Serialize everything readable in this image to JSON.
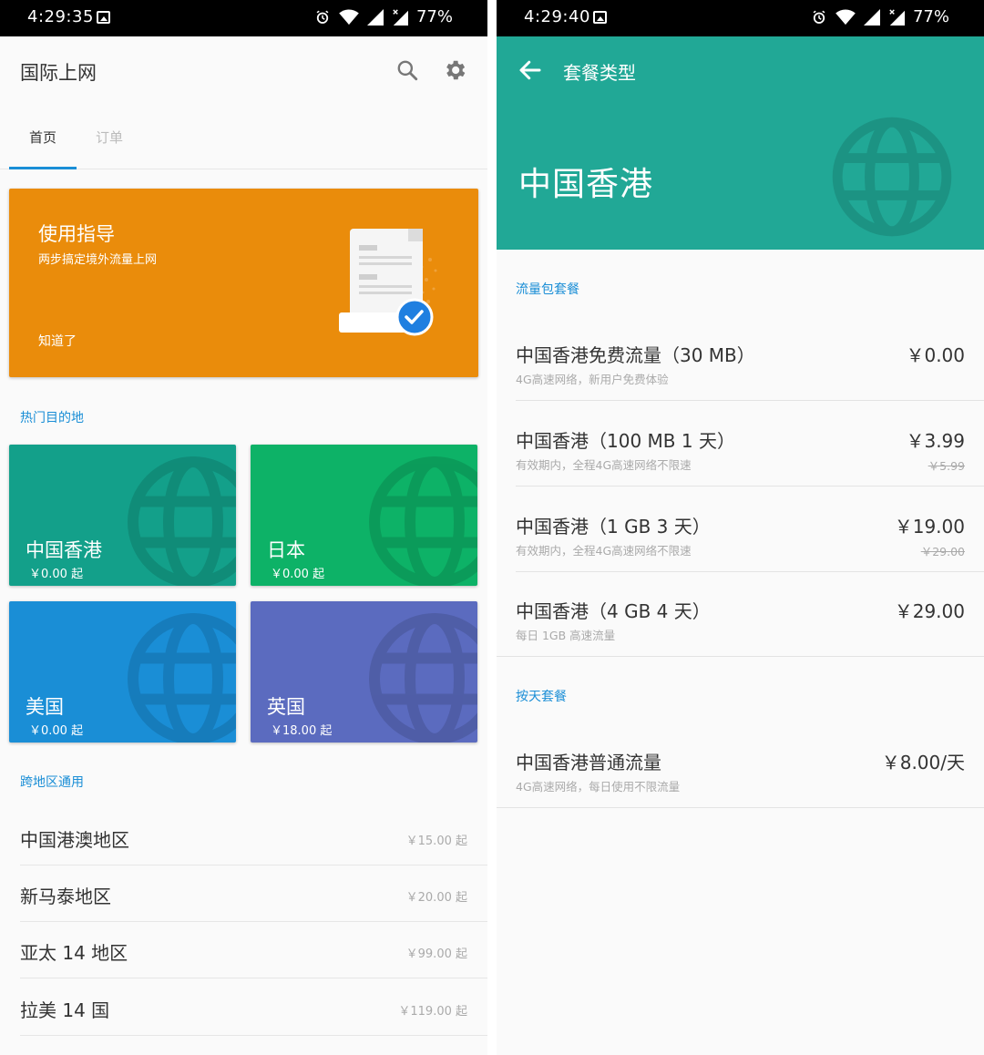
{
  "left": {
    "status": {
      "time": "4:29:35",
      "battery": "77%"
    },
    "app_title": "国际上网",
    "tabs": [
      "首页",
      "订单"
    ],
    "guide": {
      "title": "使用指导",
      "subtitle": "两步搞定境外流量上网",
      "ok": "知道了",
      "color": "#ea8c0b"
    },
    "hot_label": "热门目的地",
    "destinations": [
      {
        "name": "中国香港",
        "price": "￥0.00 起",
        "color": "#13a08a"
      },
      {
        "name": "日本",
        "price": "￥0.00 起",
        "color": "#0db267"
      },
      {
        "name": "美国",
        "price": "￥0.00 起",
        "color": "#1a8ed6"
      },
      {
        "name": "英国",
        "price": "￥18.00 起",
        "color": "#5b6bbf"
      }
    ],
    "cross_label": "跨地区通用",
    "regions": [
      {
        "name": "中国港澳地区",
        "price": "￥15.00 起"
      },
      {
        "name": "新马泰地区",
        "price": "￥20.00 起"
      },
      {
        "name": "亚太 14 地区",
        "price": "￥99.00 起"
      },
      {
        "name": "拉美 14 国",
        "price": "￥119.00 起"
      }
    ]
  },
  "right": {
    "status": {
      "time": "4:29:40",
      "battery": "77%"
    },
    "page_title": "套餐类型",
    "hero_title": "中国香港",
    "hero_color": "#21a896",
    "section1": "流量包套餐",
    "plans": [
      {
        "name": "中国香港免费流量（30 MB）",
        "desc": "4G高速网络，新用户免费体验",
        "price": "￥0.00",
        "orig": ""
      },
      {
        "name": "中国香港（100 MB 1 天）",
        "desc": "有效期内，全程4G高速网络不限速",
        "price": "￥3.99",
        "orig": "￥5.99"
      },
      {
        "name": "中国香港（1 GB 3 天）",
        "desc": "有效期内，全程4G高速网络不限速",
        "price": "￥19.00",
        "orig": "￥29.00"
      },
      {
        "name": "中国香港（4 GB 4 天）",
        "desc": "每日 1GB 高速流量",
        "price": "￥29.00",
        "orig": ""
      }
    ],
    "section2": "按天套餐",
    "daily_plan": {
      "name": "中国香港普通流量",
      "desc": "4G高速网络，每日使用不限流量",
      "price": "￥8.00/天"
    }
  },
  "icons": {
    "search": "search-icon",
    "settings": "gear-icon",
    "back": "arrow-left-icon",
    "globe": "globe-icon",
    "check": "check-icon"
  }
}
